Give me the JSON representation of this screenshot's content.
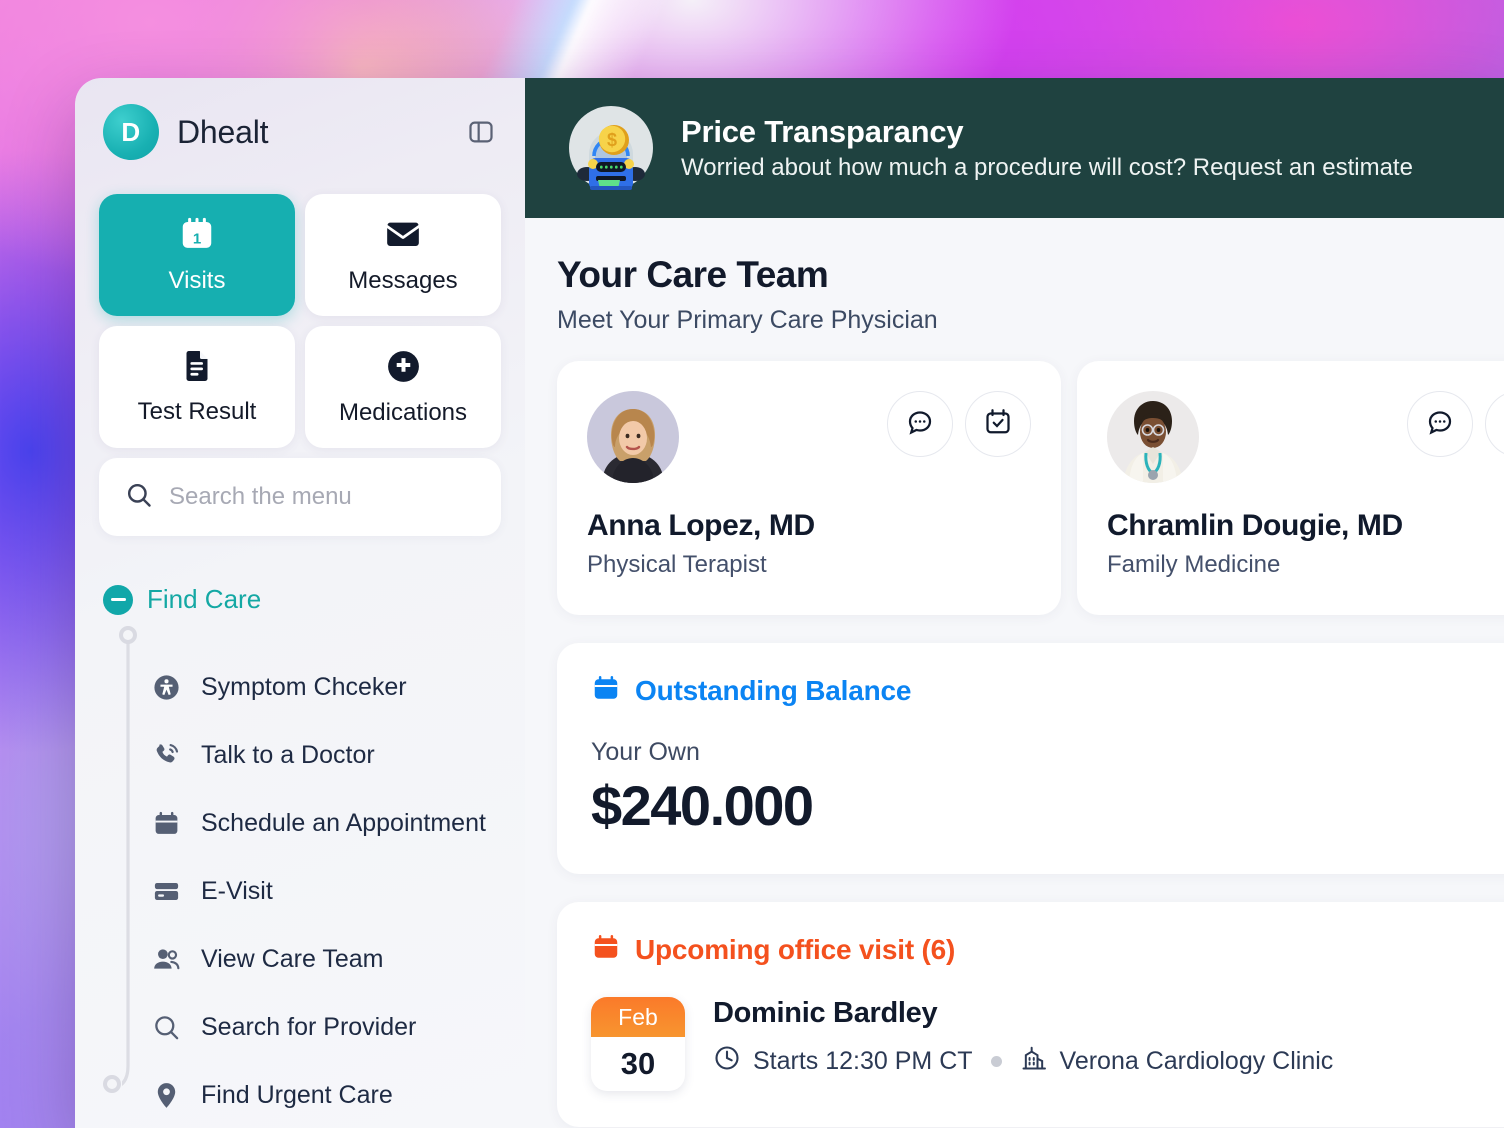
{
  "sidebar": {
    "brand": {
      "initial": "D",
      "name": "Dhealt",
      "panel_toggle_icon": "panel-collapse-icon"
    },
    "tiles": [
      {
        "label": "Visits",
        "icon": "calendar-1-icon",
        "active": true
      },
      {
        "label": "Messages",
        "icon": "envelope-icon",
        "active": false
      },
      {
        "label": "Test Result",
        "icon": "document-icon",
        "active": false
      },
      {
        "label": "Medications",
        "icon": "plus-circle-icon",
        "active": false
      }
    ],
    "search": {
      "placeholder": "Search the menu",
      "icon": "search-icon"
    },
    "section": {
      "title": "Find Care",
      "collapse_icon": "minus-circle-icon",
      "expanded": true
    },
    "items": [
      {
        "label": "Symptom Chceker",
        "icon": "accessibility-icon"
      },
      {
        "label": "Talk to a Doctor",
        "icon": "phone-call-icon"
      },
      {
        "label": "Schedule an Appointment",
        "icon": "calendar-icon"
      },
      {
        "label": "E-Visit",
        "icon": "card-icon"
      },
      {
        "label": "View Care Team",
        "icon": "users-icon"
      },
      {
        "label": "Search for Provider",
        "icon": "search-icon"
      },
      {
        "label": "Find Urgent Care",
        "icon": "map-pin-icon"
      }
    ]
  },
  "banner": {
    "icon": "atm-coin-icon",
    "title": "Price Transparancy",
    "subtitle": "Worried about how much a procedure will cost? Request an estimate",
    "bg_color": "#1f4240"
  },
  "care_team": {
    "heading": "Your Care Team",
    "subheading": "Meet Your Primary Care Physician",
    "cards": [
      {
        "name": "Anna Lopez, MD",
        "role": "Physical Terapist",
        "avatar": "avatar-anna-lopez",
        "actions": [
          {
            "icon": "chat-bubble-icon",
            "name": "message"
          },
          {
            "icon": "calendar-check-icon",
            "name": "schedule"
          }
        ]
      },
      {
        "name": "Chramlin Dougie, MD",
        "role": "Family Medicine",
        "avatar": "avatar-chramlin-dougie",
        "actions": [
          {
            "icon": "chat-bubble-icon",
            "name": "message"
          },
          {
            "icon": "calendar-check-icon",
            "name": "schedule"
          }
        ]
      }
    ]
  },
  "balance": {
    "icon": "calendar-icon",
    "title": "Outstanding Balance",
    "title_color": "#0b84f3",
    "label": "Your Own",
    "amount": "$240.000"
  },
  "upcoming": {
    "icon": "calendar-icon",
    "title": "Upcoming office visit (6)",
    "title_color": "#f4511e",
    "visits": [
      {
        "month": "Feb",
        "day": "30",
        "patient": "Dominic Bardley",
        "time": "Starts 12:30 PM CT",
        "time_icon": "clock-icon",
        "location": "Verona Cardiology Clinic",
        "location_icon": "building-icon"
      }
    ]
  }
}
